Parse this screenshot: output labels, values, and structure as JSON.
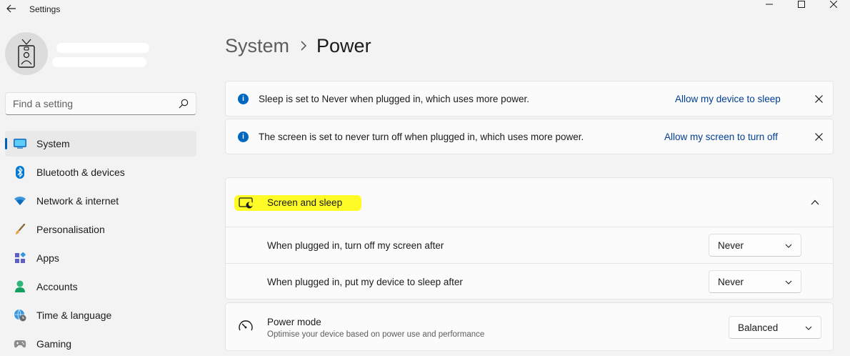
{
  "window": {
    "title": "Settings"
  },
  "profile": {
    "name": "•••• •••••",
    "email": "••••••@••••••••••"
  },
  "search": {
    "placeholder": "Find a setting"
  },
  "sidebar": {
    "items": [
      {
        "label": "System",
        "icon": "monitor-icon",
        "selected": true
      },
      {
        "label": "Bluetooth & devices",
        "icon": "bluetooth-icon"
      },
      {
        "label": "Network & internet",
        "icon": "wifi-icon"
      },
      {
        "label": "Personalisation",
        "icon": "paintbrush-icon"
      },
      {
        "label": "Apps",
        "icon": "apps-icon"
      },
      {
        "label": "Accounts",
        "icon": "person-icon"
      },
      {
        "label": "Time & language",
        "icon": "globe-clock-icon"
      },
      {
        "label": "Gaming",
        "icon": "gamepad-icon"
      }
    ]
  },
  "breadcrumb": {
    "parent": "System",
    "current": "Power"
  },
  "notices": [
    {
      "text": "Sleep is set to Never when plugged in, which uses more power.",
      "link": "Allow my device to sleep"
    },
    {
      "text": "The screen is set to never turn off when plugged in, which uses more power.",
      "link": "Allow my screen to turn off"
    }
  ],
  "screen_and_sleep": {
    "title": "Screen and sleep",
    "expanded": true,
    "highlight_color": "#fffb26",
    "rows": [
      {
        "label": "When plugged in, turn off my screen after",
        "value": "Never"
      },
      {
        "label": "When plugged in, put my device to sleep after",
        "value": "Never"
      }
    ]
  },
  "power_mode": {
    "title": "Power mode",
    "subtitle": "Optimise your device based on power use and performance",
    "value": "Balanced"
  },
  "colors": {
    "accent": "#005fb8",
    "link": "#003e92",
    "info": "#0067c0"
  }
}
